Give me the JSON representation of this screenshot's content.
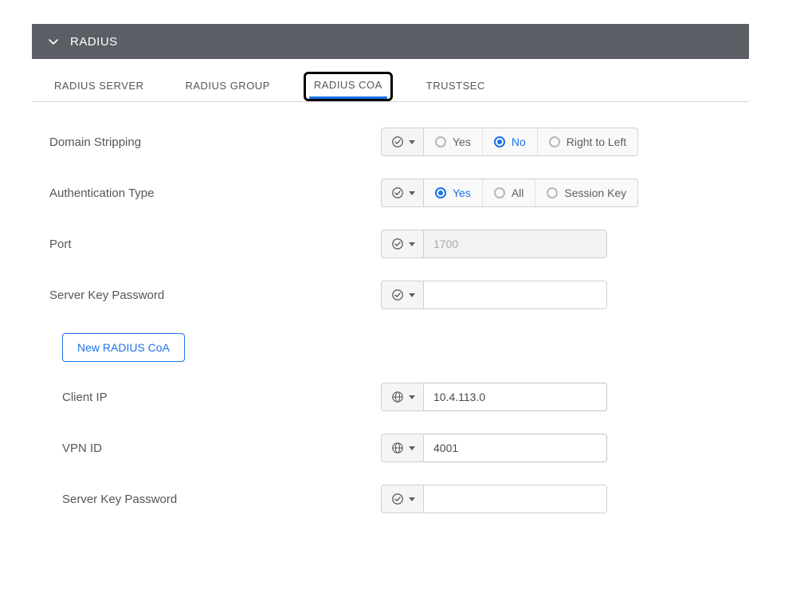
{
  "header": {
    "title": "RADIUS"
  },
  "tabs": [
    {
      "label": "RADIUS SERVER"
    },
    {
      "label": "RADIUS GROUP"
    },
    {
      "label": "RADIUS COA"
    },
    {
      "label": "TRUSTSEC"
    }
  ],
  "form": {
    "domain_stripping": {
      "label": "Domain Stripping",
      "options": {
        "yes": "Yes",
        "no": "No",
        "rtl": "Right to Left"
      },
      "selected": "no"
    },
    "auth_type": {
      "label": "Authentication Type",
      "options": {
        "yes": "Yes",
        "all": "All",
        "session": "Session Key"
      },
      "selected": "yes"
    },
    "port": {
      "label": "Port",
      "placeholder": "1700",
      "value": ""
    },
    "server_key_pw": {
      "label": "Server Key Password",
      "value": ""
    },
    "new_button": "New RADIUS CoA",
    "client_ip": {
      "label": "Client IP",
      "value": "10.4.113.0"
    },
    "vpn_id": {
      "label": "VPN ID",
      "value": "4001"
    },
    "sub_server_key_pw": {
      "label": "Server Key Password",
      "value": ""
    }
  },
  "icons": {
    "check": "check-icon",
    "globe": "globe-icon"
  }
}
